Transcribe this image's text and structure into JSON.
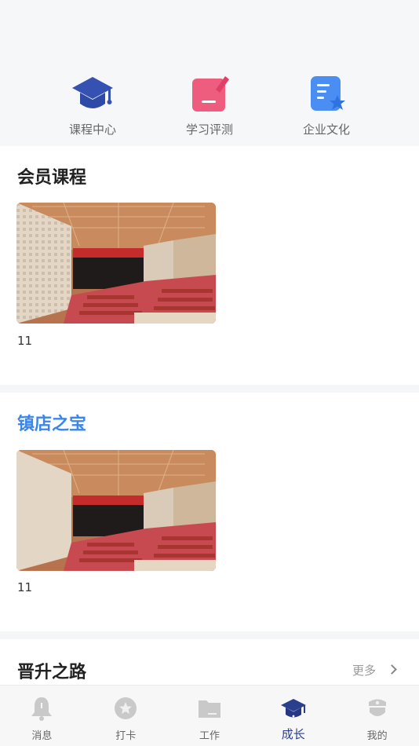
{
  "quick_entries": [
    {
      "label": "课程中心",
      "icon": "graduation-cap-icon",
      "color": "#3552b2"
    },
    {
      "label": "学习评测",
      "icon": "edit-pen-icon",
      "color": "#ee5d7e"
    },
    {
      "label": "企业文化",
      "icon": "document-star-icon",
      "color": "#4b8ef3"
    }
  ],
  "member_courses": {
    "title": "会员课程",
    "items": [
      {
        "caption": "11",
        "image": "auditorium-photo"
      }
    ]
  },
  "treasure": {
    "title": "镇店之宝",
    "title_color": "#3d86e8",
    "items": [
      {
        "caption": "11",
        "image": "auditorium-photo"
      }
    ]
  },
  "promotion": {
    "title": "晋升之路",
    "more_label": "更多"
  },
  "tabbar": {
    "active_color": "#2b3f8f",
    "tabs": [
      {
        "label": "消息",
        "icon": "bell-icon"
      },
      {
        "label": "打卡",
        "icon": "star-badge-icon"
      },
      {
        "label": "工作",
        "icon": "folder-icon"
      },
      {
        "label": "成长",
        "icon": "graduation-cap-icon",
        "active": true
      },
      {
        "label": "我的",
        "icon": "police-badge-icon"
      }
    ]
  }
}
